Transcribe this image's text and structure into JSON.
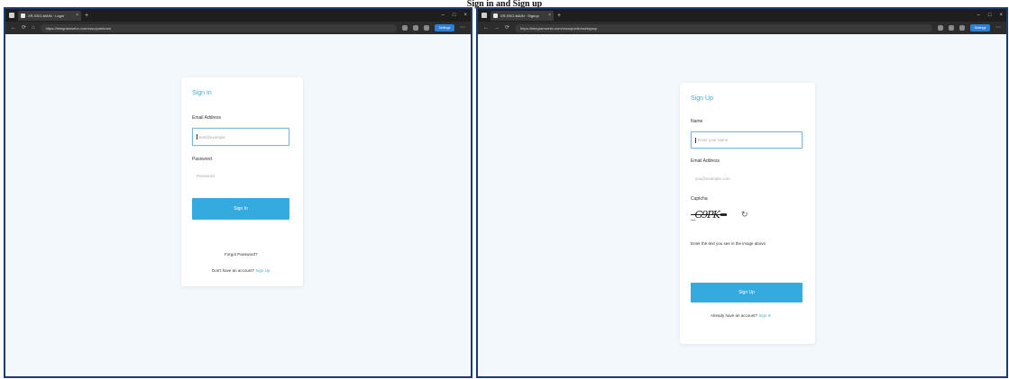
{
  "caption": "Sign in and Sign up",
  "browser": {
    "new_tab": "+",
    "minimize": "–",
    "maximize": "□",
    "close": "×",
    "back": "←",
    "forward": "→",
    "reload": "⟳",
    "home": "⌂",
    "profile_label": "Settings"
  },
  "left": {
    "tab_title": "XR-SSO-MAIN · Login",
    "url": "https://telegramwebx.com/xsso/public/ssl",
    "card": {
      "title": "Sign In",
      "email_label": "Email Address",
      "email_placeholder": "test@example",
      "password_label": "Password",
      "password_placeholder": "Password",
      "submit_label": "Sign In",
      "forgot_label": "Forgot Password?",
      "no_account_text": "Don't have an account?",
      "signup_link": "Sign Up"
    }
  },
  "right": {
    "tab_title": "XR-SSO-MAIN · Signup",
    "url": "https://telegramwebx.com/xsso/public/ssl/signup",
    "card": {
      "title": "Sign Up",
      "name_label": "Name",
      "name_placeholder": "Enter your name",
      "email_label": "Email Address",
      "email_placeholder": "you@example.com",
      "captcha_label": "Captcha",
      "captcha_text": "_G9PK=",
      "captcha_refresh": "↻",
      "captcha_hint": "Enter the text you see in the image above",
      "submit_label": "Sign Up",
      "has_account_text": "Already have an account?",
      "signin_link": "Sign In"
    }
  },
  "colors": {
    "accent": "#35aadf",
    "frame_border": "#1f3b6e",
    "page_bg": "#f3f8fc"
  }
}
